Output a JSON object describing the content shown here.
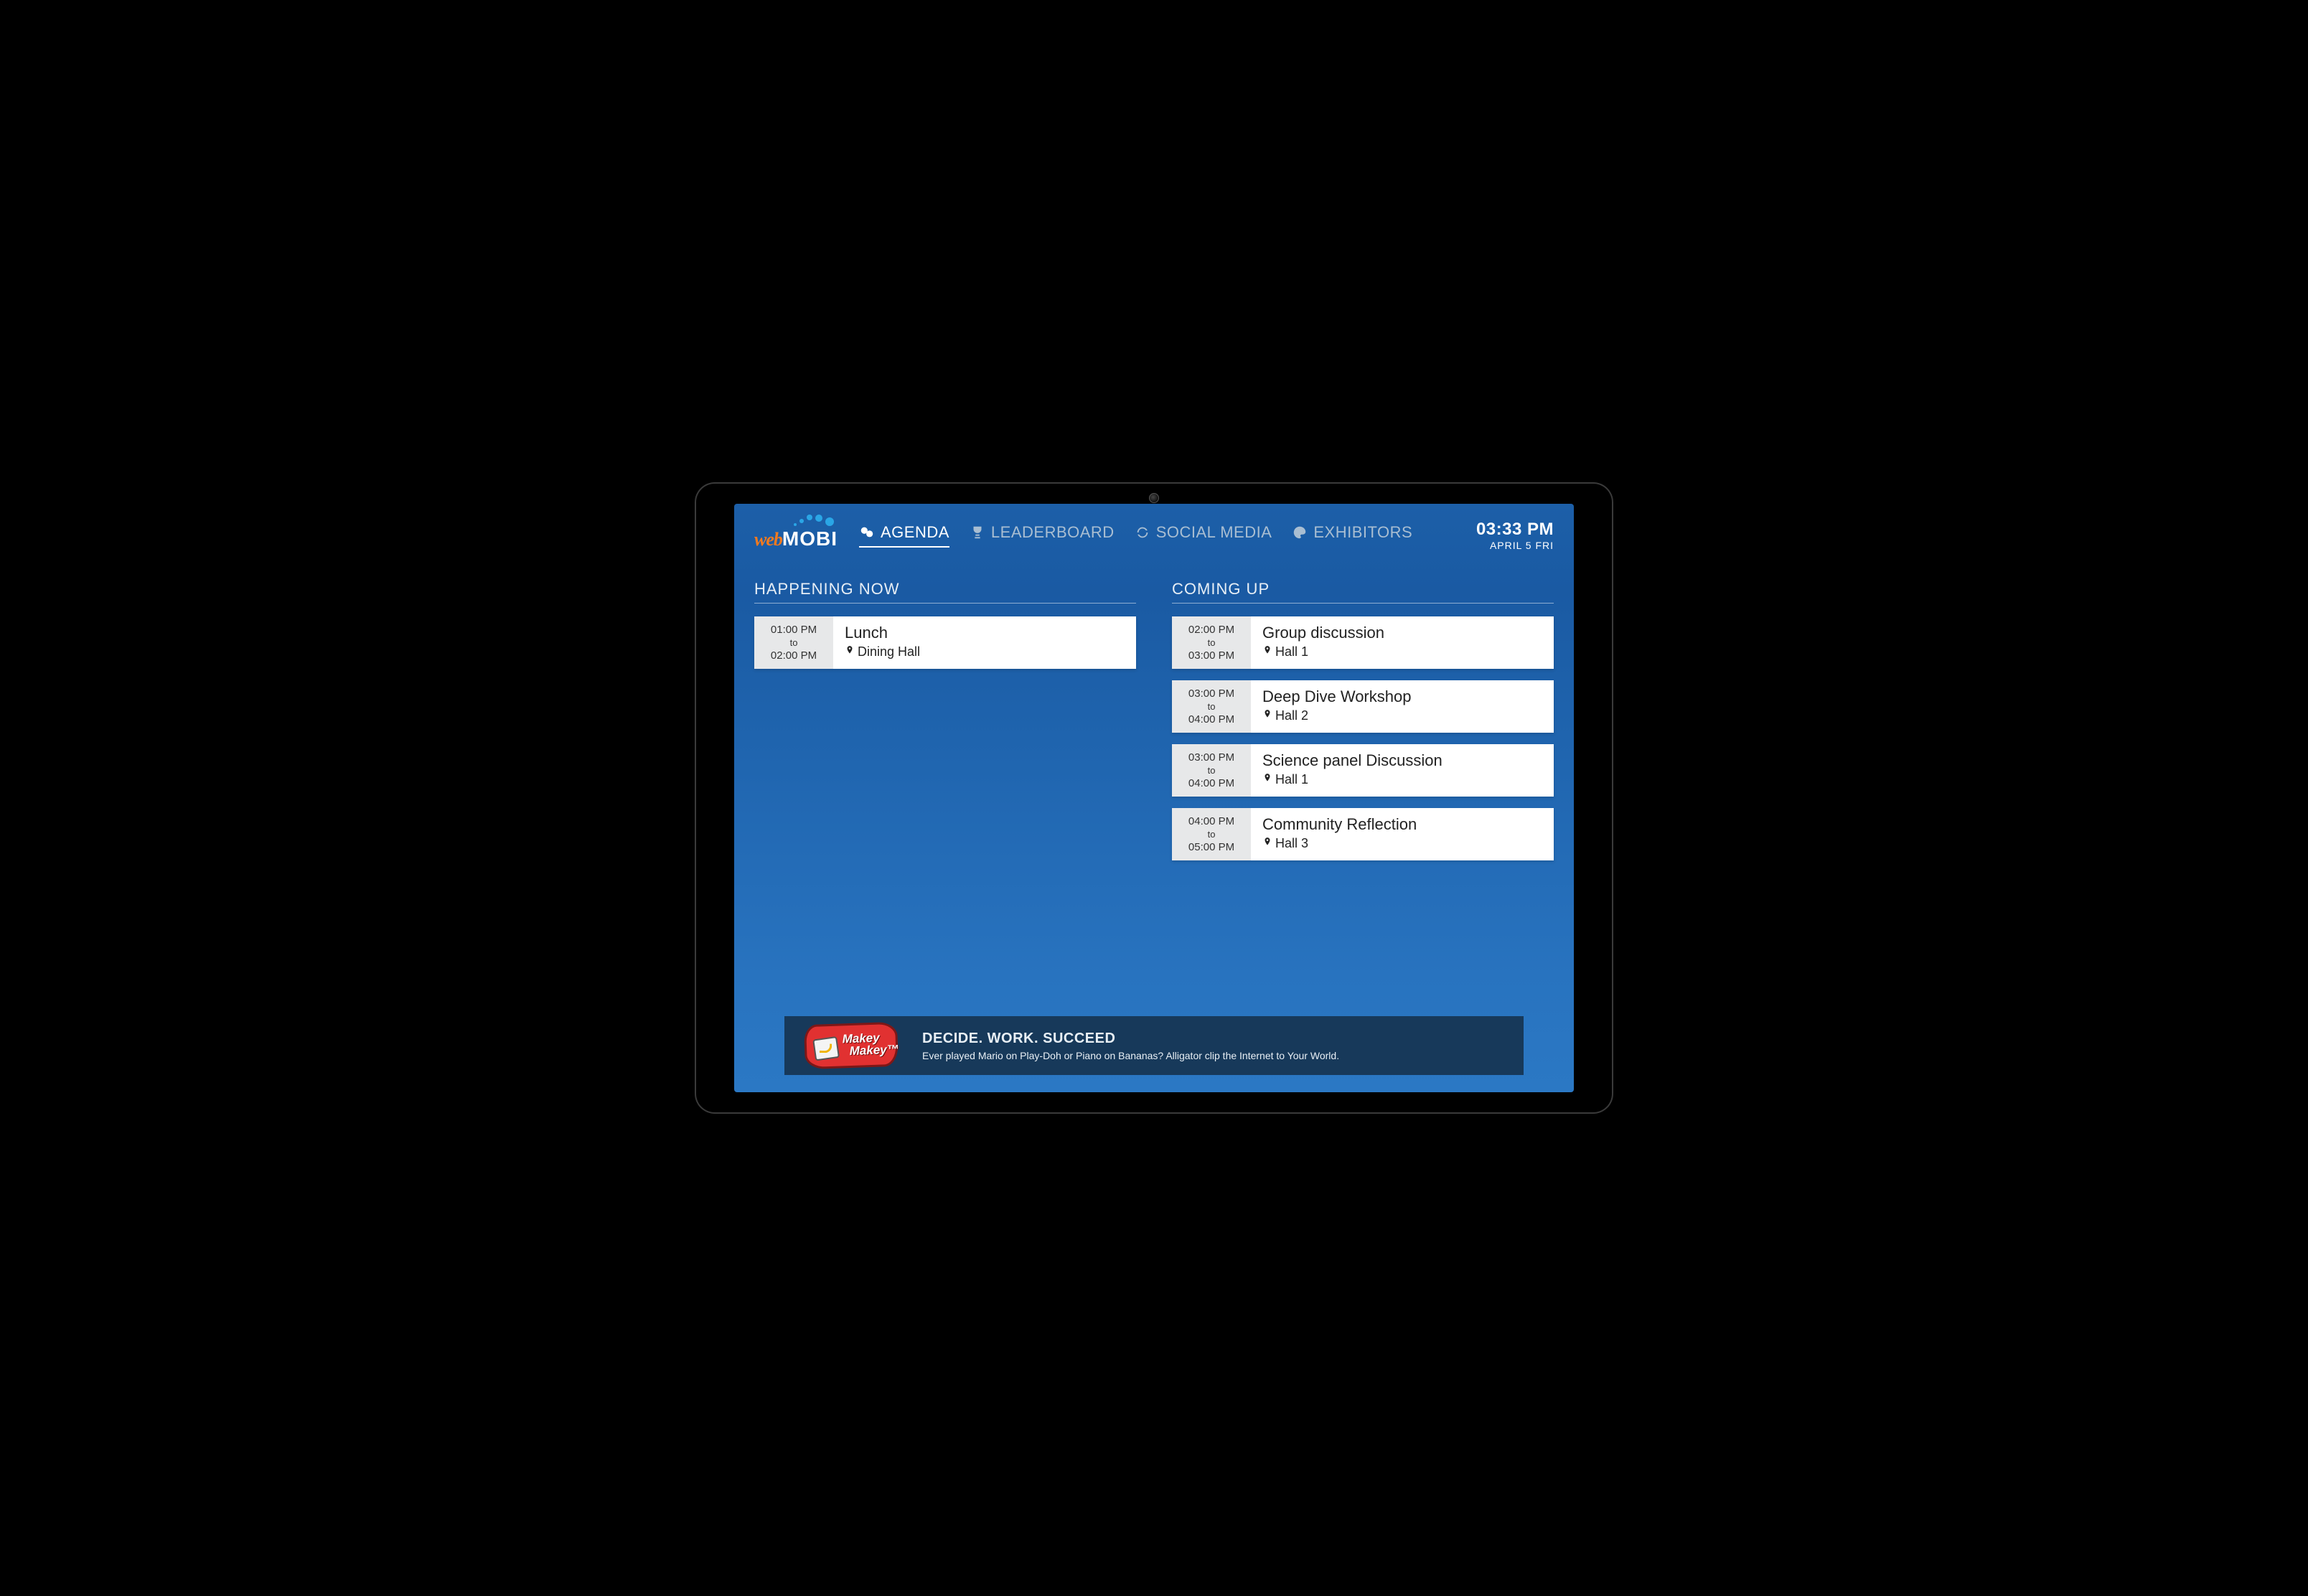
{
  "logo": {
    "part1": "web",
    "part2": "MOBI"
  },
  "nav": {
    "items": [
      {
        "label": "AGENDA"
      },
      {
        "label": "LEADERBOARD"
      },
      {
        "label": "SOCIAL MEDIA"
      },
      {
        "label": "EXHIBITORS"
      }
    ]
  },
  "clock": {
    "time": "03:33 PM",
    "date": "APRIL 5 FRI"
  },
  "sections": {
    "now_title": "HAPPENING NOW",
    "upcoming_title": "COMING UP"
  },
  "now": [
    {
      "start": "01:00 PM",
      "to": "to",
      "end": "02:00 PM",
      "title": "Lunch",
      "location": "Dining Hall"
    }
  ],
  "upcoming": [
    {
      "start": "02:00 PM",
      "to": "to",
      "end": "03:00 PM",
      "title": "Group discussion",
      "location": "Hall 1"
    },
    {
      "start": "03:00 PM",
      "to": "to",
      "end": "04:00 PM",
      "title": "Deep Dive Workshop",
      "location": "Hall 2"
    },
    {
      "start": "03:00 PM",
      "to": "to",
      "end": "04:00 PM",
      "title": "Science panel Discussion",
      "location": "Hall 1"
    },
    {
      "start": "04:00 PM",
      "to": "to",
      "end": "05:00 PM",
      "title": "Community Reflection",
      "location": "Hall 3"
    }
  ],
  "banner": {
    "logo_line1": "Makey",
    "logo_line2": "Makey",
    "title": "DECIDE. WORK. SUCCEED",
    "sub": "Ever played Mario on Play-Doh or Piano on Bananas? Alligator clip the Internet to Your World."
  }
}
